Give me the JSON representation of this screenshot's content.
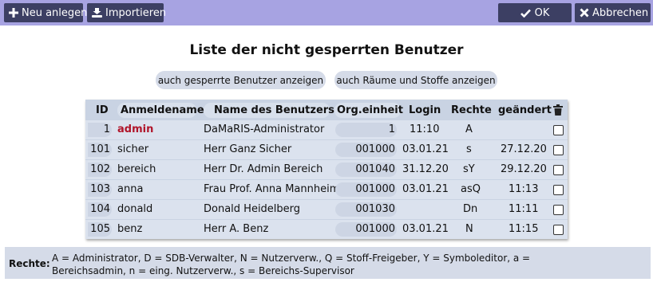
{
  "toolbar": {
    "new_label": "Neu anlegen",
    "import_label": "Importieren",
    "ok_label": "OK",
    "cancel_label": "Abbrechen"
  },
  "page_title": "Liste der nicht gesperrten Benutzer",
  "filters": {
    "show_locked": "auch gesperrte Benutzer anzeigen",
    "show_rooms": "auch Räume und Stoffe anzeigen"
  },
  "table": {
    "headers": {
      "id": "ID",
      "login_name": "Anmeldename",
      "user_name": "Name des Benutzers",
      "org_unit": "Org.einheit",
      "login": "Login",
      "rights": "Rechte",
      "changed": "geändert"
    },
    "rows": [
      {
        "id": "1",
        "login_name": "admin",
        "user_name": "DaMaRIS-Administrator",
        "org_unit": "1",
        "login": "11:10",
        "rights": "A",
        "changed": ""
      },
      {
        "id": "101",
        "login_name": "sicher",
        "user_name": "Herr Ganz Sicher",
        "org_unit": "001000",
        "login": "03.01.21",
        "rights": "s",
        "changed": "27.12.20"
      },
      {
        "id": "102",
        "login_name": "bereich",
        "user_name": "Herr Dr. Admin Bereich",
        "org_unit": "001040",
        "login": "31.12.20",
        "rights": "sY",
        "changed": "29.12.20"
      },
      {
        "id": "103",
        "login_name": "anna",
        "user_name": "Frau Prof. Anna Mannheim",
        "org_unit": "001000",
        "login": "03.01.21",
        "rights": "asQ",
        "changed": "11:13"
      },
      {
        "id": "104",
        "login_name": "donald",
        "user_name": "Donald Heidelberg",
        "org_unit": "001030",
        "login": "",
        "rights": "Dn",
        "changed": "11:11"
      },
      {
        "id": "105",
        "login_name": "benz",
        "user_name": "Herr A. Benz",
        "org_unit": "001000",
        "login": "03.01.21",
        "rights": "N",
        "changed": "11:15"
      }
    ]
  },
  "legend": {
    "label": "Rechte:",
    "text": "A = Administrator, D = SDB-Verwalter, N = Nutzerverw., Q = Stoff-Freigeber, Y = Symboleditor, a = Bereichsadmin, n = eing. Nutzerverw., s = Bereichs-Supervisor"
  },
  "colors": {
    "toolbar_bg": "#a7a3e2",
    "button_bg": "#3c3f63",
    "admin_accent": "#b0152a",
    "table_bg": "#c9d3e3"
  },
  "icons": {
    "new": "plus-icon",
    "import": "import-icon",
    "ok": "check-icon",
    "cancel": "x-icon",
    "delete_column": "trash-icon"
  }
}
